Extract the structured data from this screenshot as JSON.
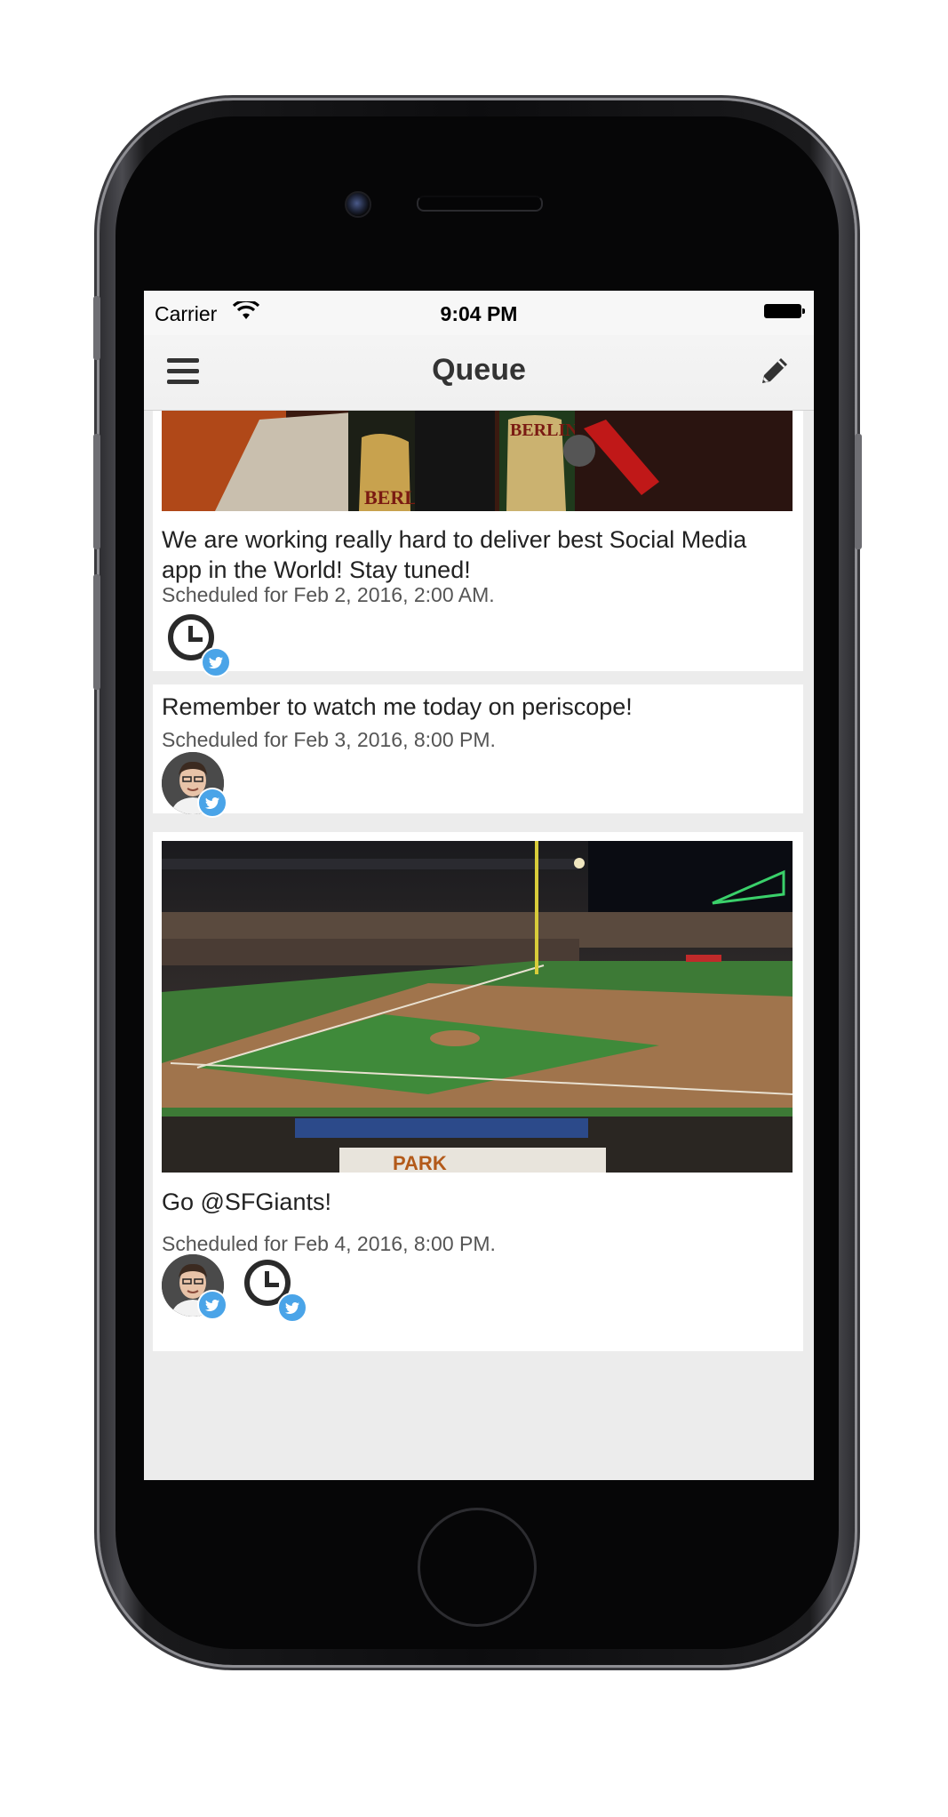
{
  "status_bar": {
    "carrier": "Carrier",
    "time": "9:04 PM"
  },
  "nav": {
    "title": "Queue",
    "menu_icon": "hamburger-menu-icon",
    "compose_icon": "pencil-icon"
  },
  "posts": [
    {
      "text": "We are working really hard to deliver best Social Media app in the World! Stay tuned!",
      "scheduled": "Scheduled for Feb 2, 2016, 2:00 AM.",
      "accounts": [
        "clock-icon"
      ]
    },
    {
      "text": "Remember to watch me today on periscope!",
      "scheduled": "Scheduled for Feb 3, 2016, 8:00 PM.",
      "accounts": [
        "user-avatar"
      ]
    },
    {
      "text": "Go @SFGiants!",
      "scheduled": "Scheduled for Feb 4, 2016, 8:00 PM.",
      "accounts": [
        "user-avatar",
        "clock-icon"
      ]
    }
  ],
  "colors": {
    "twitter_blue": "#4aa4e8",
    "nav_background": "#f2f2f2",
    "feed_background": "#ececec"
  }
}
